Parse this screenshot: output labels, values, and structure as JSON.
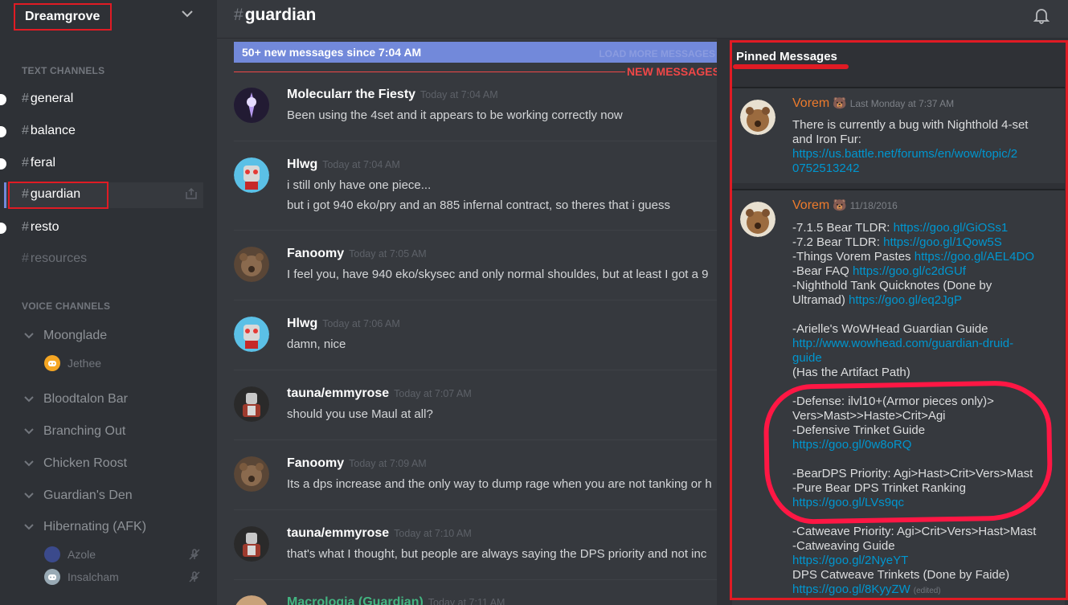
{
  "server": {
    "name": "Dreamgrove"
  },
  "sidebar": {
    "text_channels_label": "TEXT CHANNELS",
    "voice_channels_label": "VOICE CHANNELS",
    "text_channels": [
      {
        "name": "general",
        "state": "unread"
      },
      {
        "name": "balance",
        "state": "unread"
      },
      {
        "name": "feral",
        "state": "unread"
      },
      {
        "name": "guardian",
        "state": "selected"
      },
      {
        "name": "resto",
        "state": "unread"
      },
      {
        "name": "resources",
        "state": "muted"
      }
    ],
    "voice_channels": [
      {
        "name": "Moonglade",
        "users": [
          {
            "name": "Jethee",
            "avatar_color": "#f5a623"
          }
        ]
      },
      {
        "name": "Bloodtalon Bar",
        "users": []
      },
      {
        "name": "Branching Out",
        "users": []
      },
      {
        "name": "Chicken Roost",
        "users": []
      },
      {
        "name": "Guardian's Den",
        "users": []
      },
      {
        "name": "Hibernating (AFK)",
        "users": [
          {
            "name": "Azole",
            "avatar_color": "#3b4a8c",
            "muted": true
          },
          {
            "name": "Insalcham",
            "avatar_color": "#99aab5",
            "muted": true
          }
        ]
      }
    ]
  },
  "header": {
    "hash": "#",
    "channel": "guardian"
  },
  "chat": {
    "new_bar_text": "50+ new messages since 7:04 AM",
    "load_more": "LOAD MORE MESSAGES",
    "new_messages_label": "NEW MESSAGES",
    "messages": [
      {
        "author": "Molecularr the Fiesty",
        "time": "Today at 7:04 AM",
        "avatar": "purple",
        "lines": [
          "Been using the 4set and it appears to be working correctly now"
        ]
      },
      {
        "author": "Hlwg",
        "time": "Today at 7:04 AM",
        "avatar": "robot",
        "lines": [
          "i still only have one piece...",
          "but i got 940 eko/pry and an 885 infernal contract, so theres that i guess"
        ]
      },
      {
        "author": "Fanoomy",
        "time": "Today at 7:05 AM",
        "avatar": "bear",
        "lines": [
          "I feel you, have 940 eko/skysec and only normal shouldes, but at least I got a 9"
        ]
      },
      {
        "author": "Hlwg",
        "time": "Today at 7:06 AM",
        "avatar": "robot",
        "lines": [
          "damn, nice"
        ]
      },
      {
        "author": "tauna/emmyrose",
        "time": "Today at 7:07 AM",
        "avatar": "armor",
        "lines": [
          "should you use Maul at all?"
        ]
      },
      {
        "author": "Fanoomy",
        "time": "Today at 7:09 AM",
        "avatar": "bear",
        "lines": [
          "Its a dps increase and the only way to dump rage when you are not tanking or h"
        ]
      },
      {
        "author": "tauna/emmyrose",
        "time": "Today at 7:10 AM",
        "avatar": "armor",
        "lines": [
          "that's what I thought, but people are always saying the DPS priority and not inc"
        ]
      },
      {
        "author": "Macrologia (Guardian)",
        "time": "Today at 7:11 AM",
        "avatar": "tan",
        "lines": []
      }
    ]
  },
  "pinned": {
    "title": "Pinned Messages",
    "items": [
      {
        "author": "Vorem",
        "badge": "🐻",
        "time": "Last Monday at 7:37 AM",
        "lines": [
          {
            "text": "There is currently a bug with Nighthold 4-set"
          },
          {
            "text": "and Iron Fur:"
          },
          {
            "link": "https://us.battle.net/forums/en/wow/topic/2"
          },
          {
            "link": "0752513242"
          }
        ]
      },
      {
        "author": "Vorem",
        "badge": "🐻",
        "time": "11/18/2016",
        "lines": [
          {
            "text": "-7.1.5 Bear TLDR: ",
            "link": "https://goo.gl/GiOSs1"
          },
          {
            "text": "-7.2 Bear TLDR: ",
            "link": "https://goo.gl/1Qow5S"
          },
          {
            "text": "-Things Vorem Pastes ",
            "link": "https://goo.gl/AEL4DO"
          },
          {
            "text": "-Bear FAQ ",
            "link": "https://goo.gl/c2dGUf"
          },
          {
            "text": "-Nighthold Tank Quicknotes (Done by"
          },
          {
            "text": "Ultramad) ",
            "link": "https://goo.gl/eq2JgP"
          },
          {
            "text": ""
          },
          {
            "text": "-Arielle's WoWHead Guardian Guide"
          },
          {
            "link": "http://www.wowhead.com/guardian-druid-"
          },
          {
            "link": "guide"
          },
          {
            "text": "(Has the Artifact Path)"
          },
          {
            "text": ""
          },
          {
            "text": "-Defense: ilvl10+(Armor pieces only)>"
          },
          {
            "text": "Vers>Mast>>Haste>Crit>Agi"
          },
          {
            "text": "-Defensive Trinket Guide"
          },
          {
            "link": "https://goo.gl/0w8oRQ"
          },
          {
            "text": ""
          },
          {
            "text": "-BearDPS Priority: Agi>Hast>Crit>Vers>Mast"
          },
          {
            "text": "-Pure Bear DPS Trinket Ranking"
          },
          {
            "link": "https://goo.gl/LVs9qc"
          },
          {
            "text": ""
          },
          {
            "text": "-Catweave Priority: Agi>Crit>Vers>Hast>Mast"
          },
          {
            "text": "-Catweaving Guide"
          },
          {
            "link": "https://goo.gl/2NyeYT"
          },
          {
            "text": "DPS Catweave Trinkets (Done by Faide)"
          },
          {
            "link": "https://goo.gl/8KyyZW",
            "edited": "(edited)"
          }
        ]
      }
    ]
  },
  "colors": {
    "accent": "#7289da",
    "annotation_red": "#e01b24",
    "link": "#0096cf",
    "author_orange": "#ed7b2c"
  }
}
